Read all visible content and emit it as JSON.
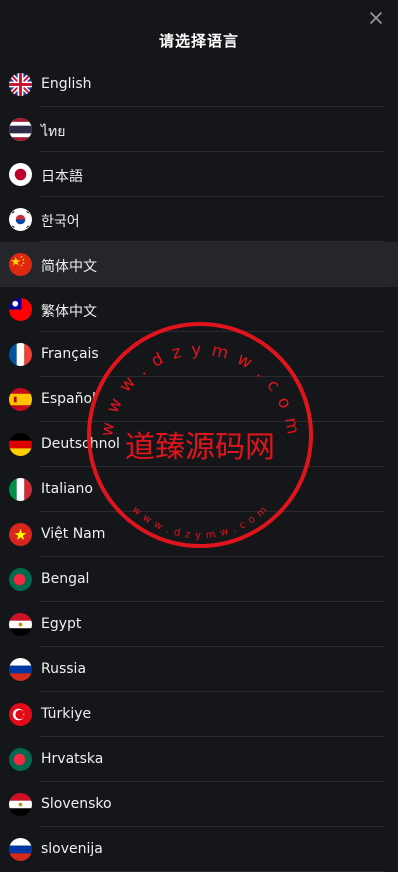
{
  "header": {
    "title": "请选择语言",
    "close_icon": "close-icon"
  },
  "languages": [
    {
      "label": "English",
      "flag": "uk-flag-icon"
    },
    {
      "label": "ไทย",
      "flag": "thailand-flag-icon"
    },
    {
      "label": "日本語",
      "flag": "japan-flag-icon"
    },
    {
      "label": "한국어",
      "flag": "korea-flag-icon"
    },
    {
      "label": "简体中文",
      "flag": "china-flag-icon",
      "selected": true
    },
    {
      "label": "繁体中文",
      "flag": "taiwan-flag-icon"
    },
    {
      "label": "Français",
      "flag": "france-flag-icon"
    },
    {
      "label": "Español",
      "flag": "spain-flag-icon"
    },
    {
      "label": "Deutschnol",
      "flag": "germany-flag-icon"
    },
    {
      "label": "Italiano",
      "flag": "italy-flag-icon"
    },
    {
      "label": "Việt Nam",
      "flag": "vietnam-flag-icon"
    },
    {
      "label": "Bengal",
      "flag": "bangladesh-flag-icon"
    },
    {
      "label": "Egypt",
      "flag": "egypt-flag-icon"
    },
    {
      "label": "Russia",
      "flag": "russia-flag-icon"
    },
    {
      "label": "Türkiye",
      "flag": "turkey-flag-icon"
    },
    {
      "label": "Hrvatska",
      "flag": "bangladesh-flag-icon"
    },
    {
      "label": "Slovensko",
      "flag": "egypt-flag-icon"
    },
    {
      "label": "slovenija",
      "flag": "russia-flag-icon"
    }
  ],
  "watermark": {
    "center_text": "道臻源码网",
    "top_arc": "w w w . d z y m w . c o m",
    "bottom_arc": "w w w . d z y m w . c o m",
    "color": "#e0141c"
  },
  "colors": {
    "background": "#15161a",
    "selected_row": "#25262b",
    "divider": "#2a2b30"
  }
}
